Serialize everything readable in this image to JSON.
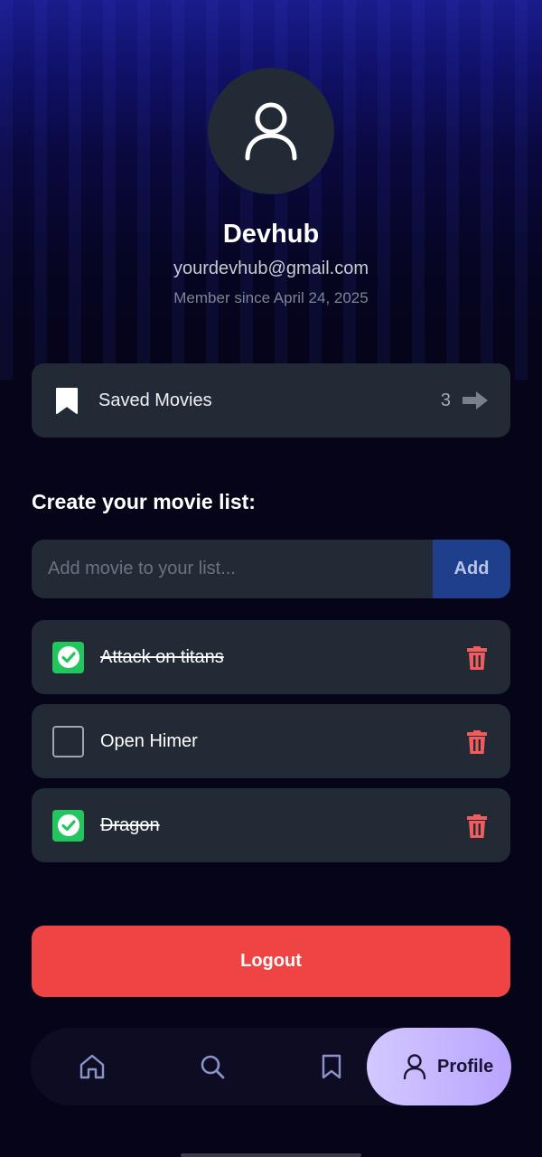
{
  "profile": {
    "name": "Devhub",
    "email": "yourdevhub@gmail.com",
    "member_since": "Member since April 24, 2025",
    "avatar_icon": "user-icon"
  },
  "saved_movies": {
    "label": "Saved Movies",
    "count": "3",
    "icon": "bookmark-icon",
    "arrow_icon": "arrow-right-icon"
  },
  "movie_list": {
    "title": "Create your movie list:",
    "input_placeholder": "Add movie to your list...",
    "input_value": "",
    "add_label": "Add",
    "items": [
      {
        "title": "Attack on titans",
        "done": true
      },
      {
        "title": "Open Himer",
        "done": false
      },
      {
        "title": "Dragon",
        "done": true
      }
    ]
  },
  "logout_label": "Logout",
  "nav": {
    "items": [
      {
        "icon": "home-icon",
        "label": ""
      },
      {
        "icon": "search-icon",
        "label": ""
      },
      {
        "icon": "bookmark-icon",
        "label": ""
      },
      {
        "icon": "user-icon",
        "label": "Profile",
        "active": true
      }
    ]
  },
  "colors": {
    "accent_green": "#22c55e",
    "danger_red": "#ef4444",
    "add_button_blue": "#1e3f8c",
    "card_bg": "#222a36",
    "active_nav_purple": "#c4b5fd"
  }
}
